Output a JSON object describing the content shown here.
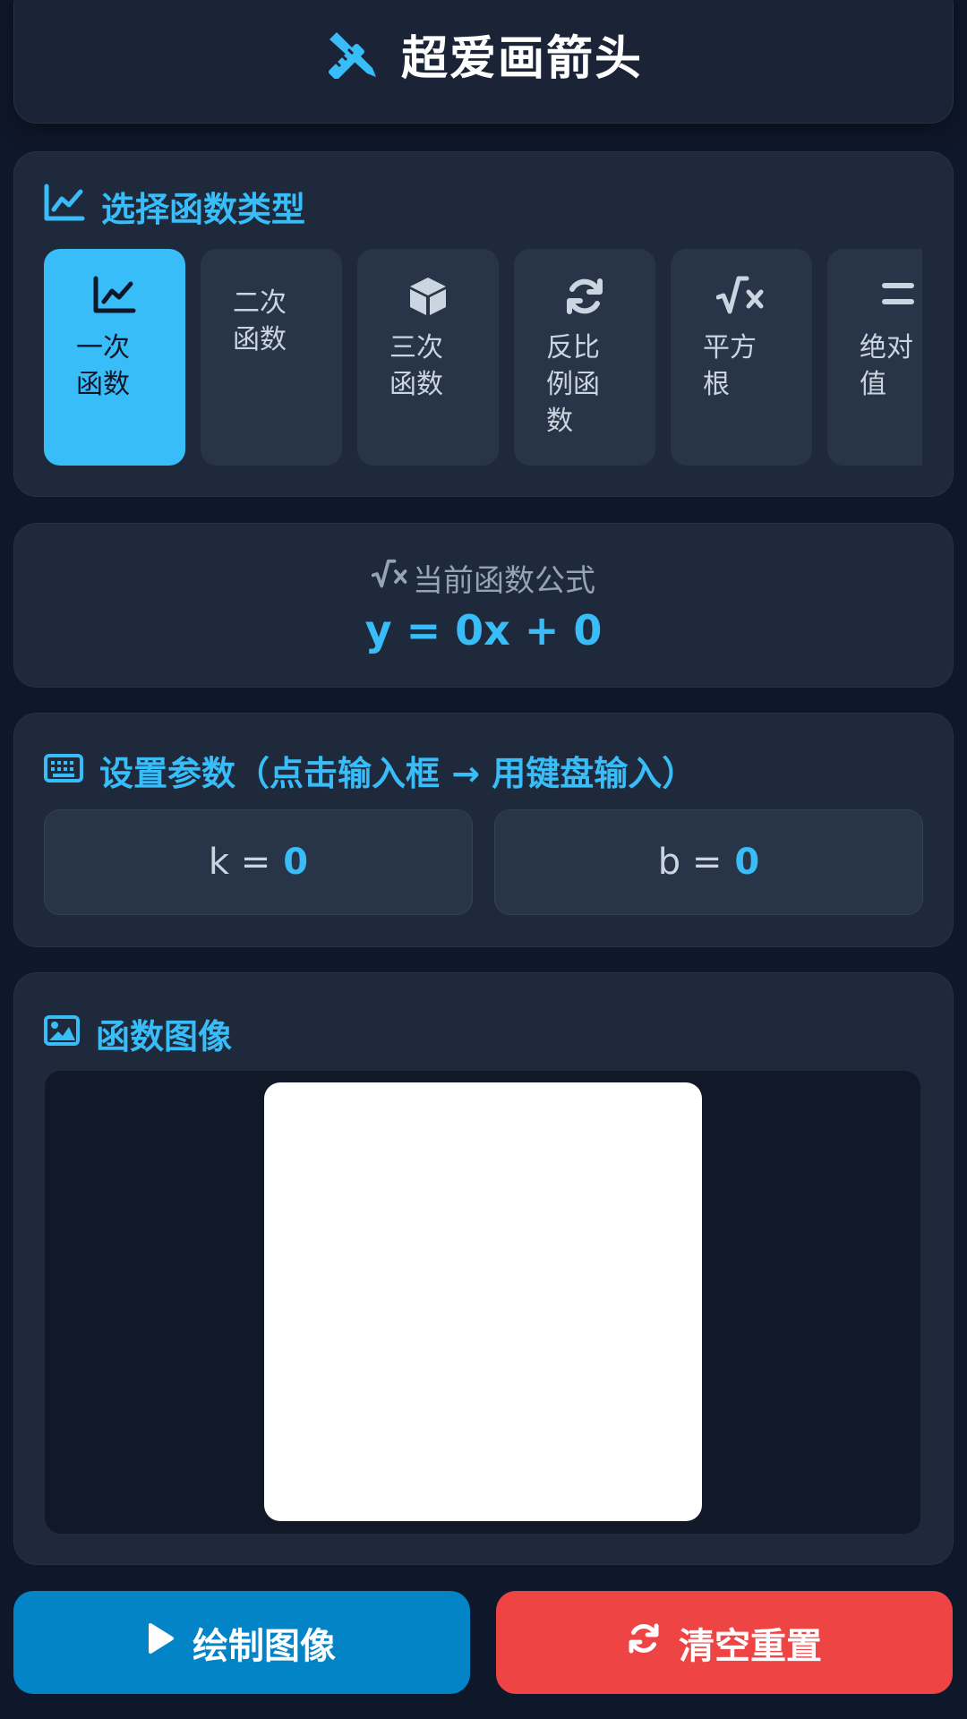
{
  "header": {
    "title": "超爱画箭头",
    "icon": "pencil-ruler-icon"
  },
  "function_types": {
    "title": "选择函数类型",
    "icon": "chart-line-icon",
    "selected": "一次函数",
    "items": [
      {
        "label": "一次函数",
        "icon": "chart-line-icon",
        "active": true
      },
      {
        "label": "二次函数",
        "icon": "",
        "active": false
      },
      {
        "label": "三次函数",
        "icon": "cube-icon",
        "active": false
      },
      {
        "label": "反比例函数",
        "icon": "sync-icon",
        "active": false
      },
      {
        "label": "平方根",
        "icon": "square-root-icon",
        "active": false
      },
      {
        "label": "绝对值",
        "icon": "equals-icon",
        "active": false
      }
    ]
  },
  "formula": {
    "label": "当前函数公式",
    "icon": "square-root-icon",
    "text": "y = 0x + 0"
  },
  "params": {
    "title": "设置参数（点击输入框 → 用键盘输入）",
    "icon": "keyboard-icon",
    "fields": [
      {
        "name": "k =",
        "value": "0"
      },
      {
        "name": "b =",
        "value": "0"
      }
    ]
  },
  "graph": {
    "title": "函数图像",
    "icon": "image-icon"
  },
  "actions": {
    "draw_label": "绘制图像",
    "reset_label": "清空重置",
    "colors": {
      "draw": "#0284c7",
      "reset": "#ef4444"
    }
  },
  "colors": {
    "accent": "#38bdf8",
    "background": "#0f172a",
    "card": "#1e293b"
  }
}
